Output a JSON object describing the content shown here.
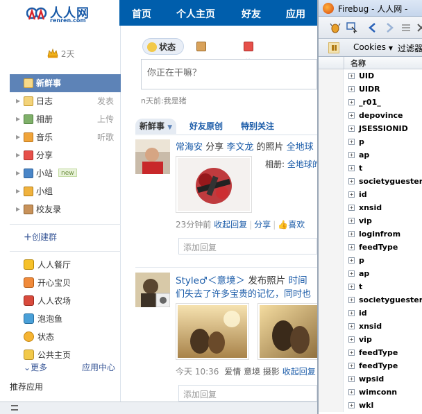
{
  "site": {
    "logo_text": "人人网",
    "logo_domain": "renren.com"
  },
  "nav": {
    "items": [
      "首页",
      "个人主页",
      "好友",
      "应用"
    ]
  },
  "profile": {
    "days": "2天"
  },
  "sidebar": {
    "items": [
      {
        "label": "新鲜事",
        "action": ""
      },
      {
        "label": "日志",
        "action": "发表"
      },
      {
        "label": "相册",
        "action": "上传"
      },
      {
        "label": "音乐",
        "action": "听歌"
      },
      {
        "label": "分享",
        "action": ""
      },
      {
        "label": "小站",
        "action": "",
        "badge": "new"
      },
      {
        "label": "小组",
        "action": ""
      },
      {
        "label": "校友录",
        "action": ""
      }
    ],
    "create_group": "创建群",
    "apps": [
      "人人餐厅",
      "开心宝贝",
      "人人农场",
      "泡泡鱼",
      "状态",
      "公共主页"
    ],
    "more": "更多",
    "app_center": "应用中心",
    "recommend": "推荐应用"
  },
  "publisher": {
    "tabs": [
      "状态",
      "照片",
      "分享"
    ],
    "placeholder": "你正在干嘛？",
    "last_status": "n天前:我是猪"
  },
  "feed_tabs": [
    "新鲜事",
    "好友原创",
    "特别关注"
  ],
  "feeds": [
    {
      "user": "常海安",
      "verb": "分享",
      "target": "李文龙",
      "object": "的照片",
      "album_prefix": "全地球",
      "album_label": "相册:",
      "album_name": "全地球的",
      "time": "23分钟前",
      "actions": [
        "收起回复",
        "分享",
        "喜欢"
      ],
      "reply_placeholder": "添加回复"
    },
    {
      "user": "Style♂＜意境＞",
      "verb": "发布照片",
      "extra": "时间",
      "desc": "们失去了许多宝贵的记忆，同时也",
      "time": "今天 10:36",
      "tags": "爱情 意境 摄影",
      "actions": [
        "收起回复"
      ],
      "reply_placeholder": "添加回复"
    }
  ],
  "firebug": {
    "title": "Firebug - 人人网 -",
    "tab": "Cookies",
    "filter": "过滤器",
    "column": "名称",
    "cookies": [
      "UID",
      "UIDR",
      "_r01_",
      "depovince",
      "JSESSIONID",
      "p",
      "ap",
      "t",
      "societyguester",
      "id",
      "xnsid",
      "vip",
      "loginfrom",
      "feedType",
      "p",
      "ap",
      "t",
      "societyguester",
      "id",
      "xnsid",
      "vip",
      "feedType",
      "feedType",
      "wpsid",
      "wimconn",
      "wkl"
    ]
  },
  "colors": {
    "nav_blue": "#005eac",
    "link_blue": "#1a5ba8",
    "active_menu": "#5d83b7"
  }
}
